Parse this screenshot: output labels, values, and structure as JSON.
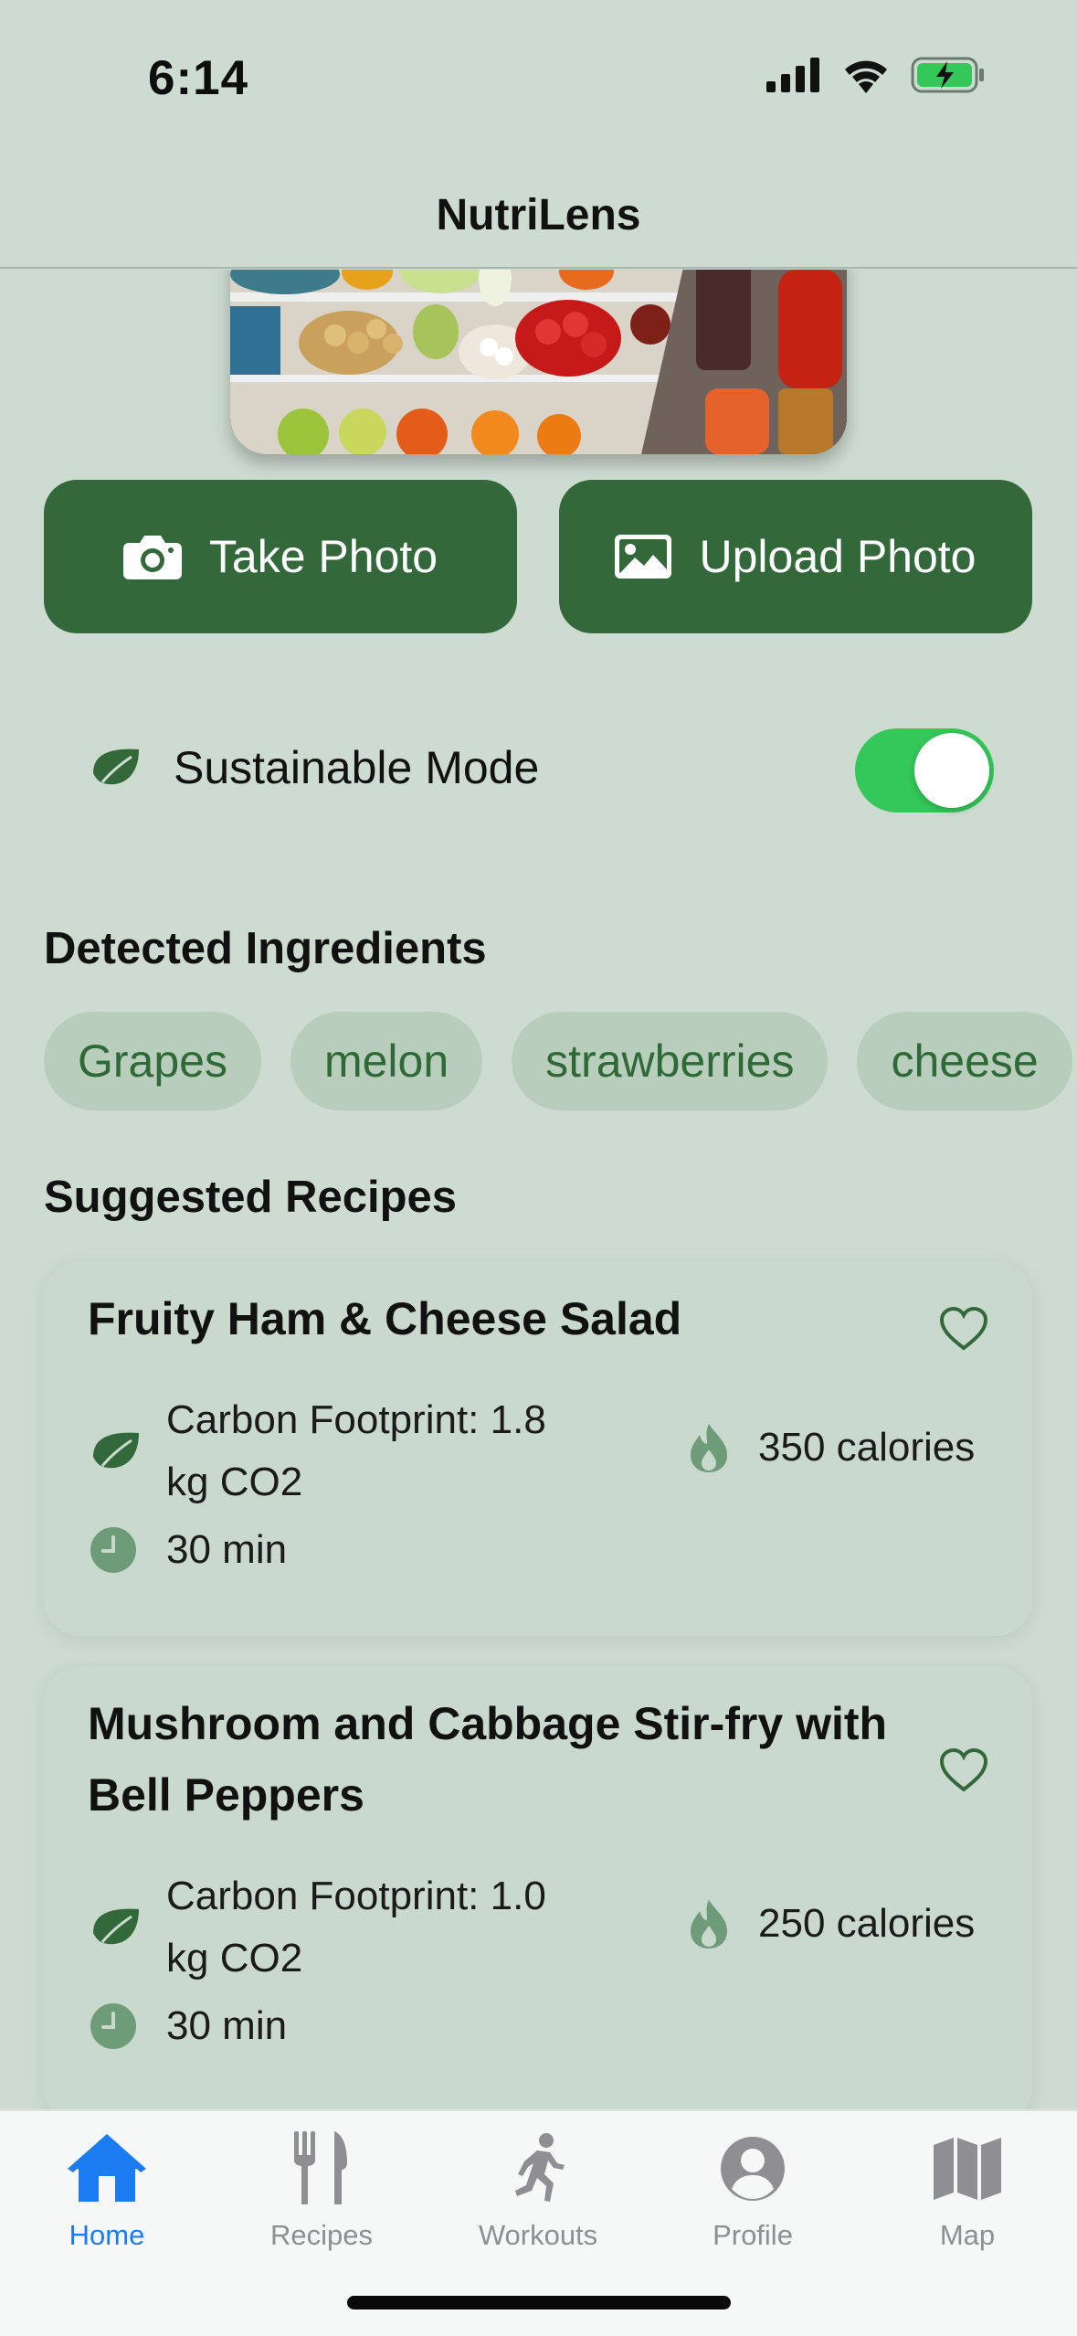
{
  "status_bar": {
    "time": "6:14"
  },
  "nav": {
    "title": "NutriLens"
  },
  "actions": {
    "take_photo": "Take Photo",
    "upload_photo": "Upload Photo"
  },
  "sustainable": {
    "label": "Sustainable Mode",
    "enabled": true
  },
  "ingredients": {
    "title": "Detected Ingredients",
    "items": [
      "Grapes",
      "melon",
      "strawberries",
      "cheese"
    ]
  },
  "recipes": {
    "title": "Suggested Recipes",
    "items": [
      {
        "title_line1": "Fruity Ham & Cheese Salad",
        "title_line2": "",
        "carbon_line1": "Carbon Footprint: 1.8",
        "carbon_line2": "kg CO2",
        "calories": "350 calories",
        "time": "30 min"
      },
      {
        "title_line1": "Mushroom and Cabbage Stir-fry with",
        "title_line2": "Bell Peppers",
        "carbon_line1": "Carbon Footprint: 1.0",
        "carbon_line2": "kg CO2",
        "calories": "250 calories",
        "time": "30 min"
      }
    ]
  },
  "tabs": [
    "Home",
    "Recipes",
    "Workouts",
    "Profile",
    "Map"
  ],
  "colors": {
    "accent": "#33693a",
    "background": "#cddbd1",
    "toggle_on": "#34c759",
    "tab_active": "#1a7cf0"
  }
}
